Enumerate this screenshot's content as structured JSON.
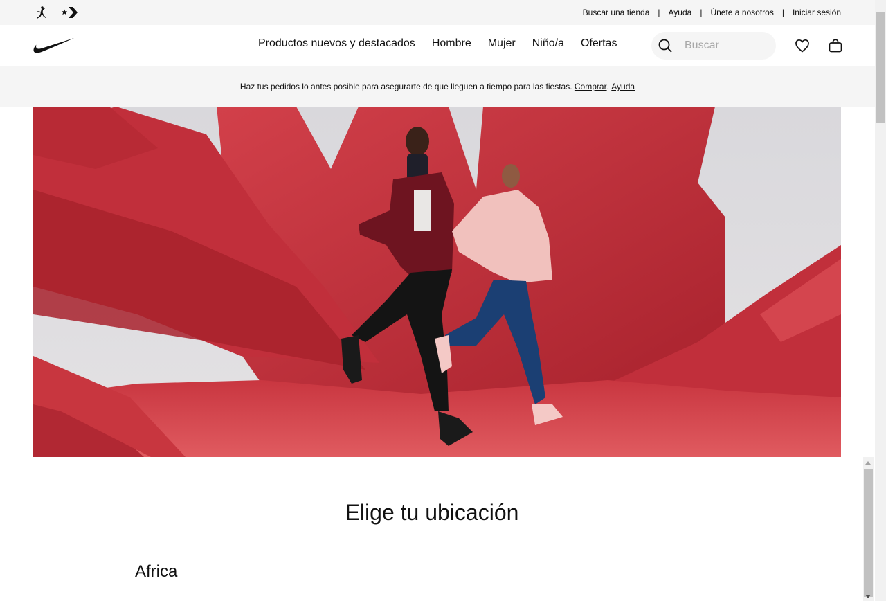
{
  "utility_bar": {
    "brand_icons": [
      "jordan-jumpman-icon",
      "converse-star-chevron-icon"
    ],
    "links": [
      "Buscar una tienda",
      "Ayuda",
      "Únete a nosotros",
      "Iniciar sesión"
    ],
    "separator": "|"
  },
  "header": {
    "logo": "nike-swoosh-icon",
    "nav": [
      "Productos nuevos y destacados",
      "Hombre",
      "Mujer",
      "Niño/a",
      "Ofertas"
    ],
    "search": {
      "placeholder": "Buscar",
      "value": ""
    },
    "icons": [
      "favorites-heart-icon",
      "shopping-bag-icon"
    ]
  },
  "promo": {
    "text": "Haz tus pedidos lo antes posible para asegurarte de que lleguen a tiempo para las fiestas.",
    "link_shop": "Comprar",
    "link_sep": ".",
    "link_help": "Ayuda"
  },
  "hero": {
    "image": "runners-in-red-paper-photo"
  },
  "location": {
    "title": "Elige tu ubicación",
    "regions": [
      "Africa"
    ]
  },
  "colors": {
    "utility_bg": "#f5f5f5",
    "text": "#111111",
    "hero_red": "#c9353f",
    "hero_bg": "#d7d6da"
  }
}
